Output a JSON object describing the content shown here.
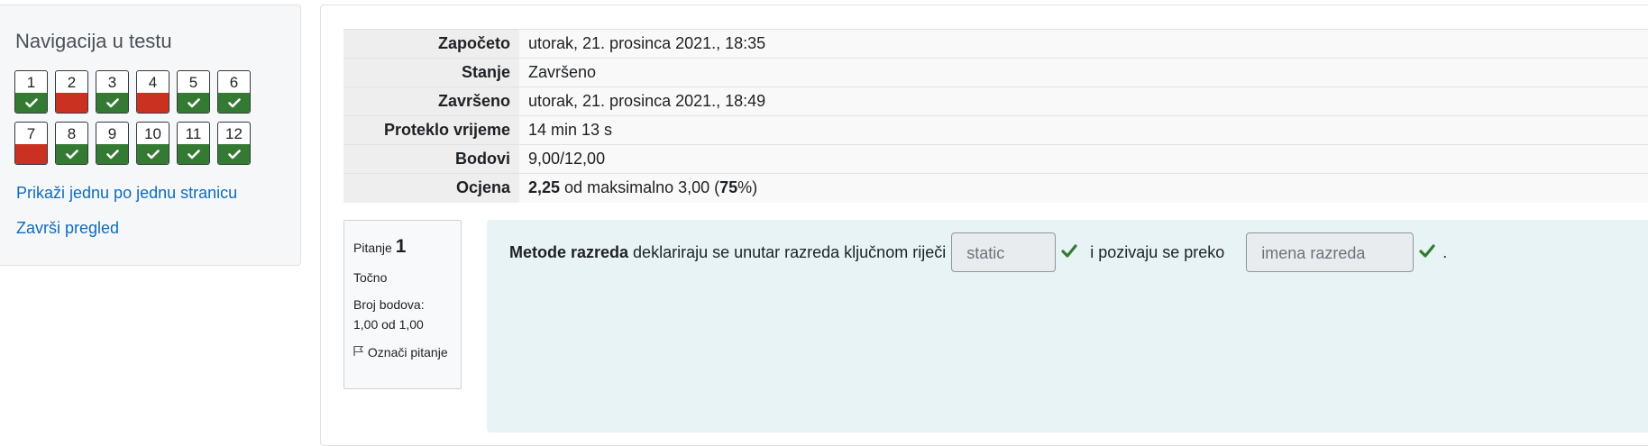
{
  "navigation": {
    "title": "Navigacija u testu",
    "questions": [
      {
        "num": "1",
        "state": "correct"
      },
      {
        "num": "2",
        "state": "incorrect"
      },
      {
        "num": "3",
        "state": "correct"
      },
      {
        "num": "4",
        "state": "incorrect"
      },
      {
        "num": "5",
        "state": "correct"
      },
      {
        "num": "6",
        "state": "correct"
      },
      {
        "num": "7",
        "state": "incorrect"
      },
      {
        "num": "8",
        "state": "correct"
      },
      {
        "num": "9",
        "state": "correct"
      },
      {
        "num": "10",
        "state": "correct"
      },
      {
        "num": "11",
        "state": "correct"
      },
      {
        "num": "12",
        "state": "correct"
      }
    ],
    "show_one_page_link": "Prikaži jednu po jednu stranicu",
    "finish_review_link": "Završi pregled"
  },
  "summary": {
    "started_label": "Započeto",
    "started_value": "utorak, 21. prosinca 2021., 18:35",
    "state_label": "Stanje",
    "state_value": "Završeno",
    "completed_label": "Završeno",
    "completed_value": "utorak, 21. prosinca 2021., 18:49",
    "time_label": "Proteklo vrijeme",
    "time_value": "14 min 13 s",
    "marks_label": "Bodovi",
    "marks_value": "9,00/12,00",
    "grade_label": "Ocjena",
    "grade_score": "2,25",
    "grade_middle": " od maksimalno 3,00 (",
    "grade_percent": "75",
    "grade_end": "%)"
  },
  "question": {
    "label": "Pitanje",
    "number": "1",
    "state": "Točno",
    "grade_label": "Broj bodova:",
    "grade_value": "1,00 od 1,00",
    "flag_label": "Označi pitanje",
    "text_bold": "Metode razreda",
    "text_part1": " deklariraju se unutar razreda ključnom riječi",
    "answer1": "static",
    "text_part2": "i pozivaju se preko",
    "answer2": "imena razreda",
    "text_end": "."
  },
  "colors": {
    "correct": "#357a32",
    "incorrect": "#ca3120",
    "link": "#0f6cbf",
    "question_bg": "#e7f3f5"
  },
  "icons": {
    "check": "check-icon",
    "flag": "flag-icon"
  }
}
